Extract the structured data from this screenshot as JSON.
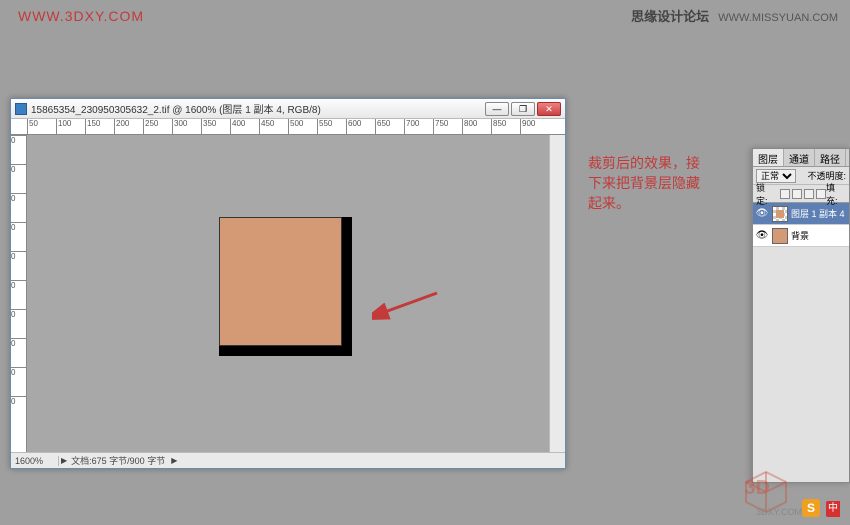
{
  "watermarks": {
    "topLeft": "WWW.3DXY.COM",
    "topRightBold": "思缘设计论坛",
    "topRightUrl": "WWW.MISSYUAN.COM",
    "bottomUrl": "3DXY.COM",
    "mark3d": "3D"
  },
  "psWindow": {
    "title": "15865354_230950305632_2.tif @ 1600% (图层 1 副本 4, RGB/8)",
    "rulerH": [
      "50",
      "100",
      "150",
      "200",
      "250",
      "300",
      "350",
      "400",
      "450",
      "500",
      "550",
      "600",
      "650",
      "700",
      "750",
      "800",
      "850",
      "900"
    ],
    "rulerV": [
      "0",
      "0",
      "0",
      "0",
      "0",
      "0",
      "0",
      "0",
      "0",
      "0"
    ],
    "zoom": "1600%",
    "docInfo": "文档:675 字节/900 字节",
    "chev": "▶"
  },
  "annotation": {
    "line1": "裁剪后的效果，接",
    "line2": "下来把背景层隐藏",
    "line3": "起来。"
  },
  "layersPanel": {
    "tabs": [
      "图层",
      "通道",
      "路径"
    ],
    "blendMode": "正常",
    "opacityLabel": "不透明度:",
    "lockLabel": "锁定:",
    "fillLabel": "填充:",
    "layers": [
      {
        "name": "图层 1 副本 4",
        "selected": true,
        "thumb": "checker"
      },
      {
        "name": "背景",
        "selected": false,
        "thumb": "solid"
      }
    ]
  },
  "badges": {
    "s": "S",
    "cn": "中"
  }
}
